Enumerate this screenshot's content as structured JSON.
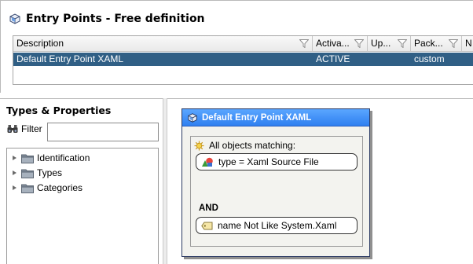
{
  "header": {
    "title": "Entry Points - Free definition",
    "icon": "entry-point-icon"
  },
  "table": {
    "columns": [
      {
        "label": "Description"
      },
      {
        "label": "Activa..."
      },
      {
        "label": "Up..."
      },
      {
        "label": "Pack..."
      },
      {
        "label": "N"
      }
    ],
    "rows": [
      {
        "description": "Default Entry Point XAML",
        "activation": "ACTIVE",
        "updated": "",
        "package": "custom",
        "n": ""
      }
    ],
    "selection_color": "#305f85"
  },
  "types_panel": {
    "title": "Types & Properties",
    "filter_label": "Filter",
    "filter_value": "",
    "tree": [
      {
        "label": "Identification"
      },
      {
        "label": "Types"
      },
      {
        "label": "Categories"
      }
    ]
  },
  "card": {
    "title": "Default Entry Point XAML",
    "header_color": "#3a88f5",
    "match_label": "All objects matching:",
    "conditions": [
      {
        "text": "type = Xaml Source File",
        "icon": "type-shapes-icon"
      },
      {
        "text": "name Not Like System.Xaml",
        "icon": "tag-icon"
      }
    ],
    "operator": "AND"
  }
}
